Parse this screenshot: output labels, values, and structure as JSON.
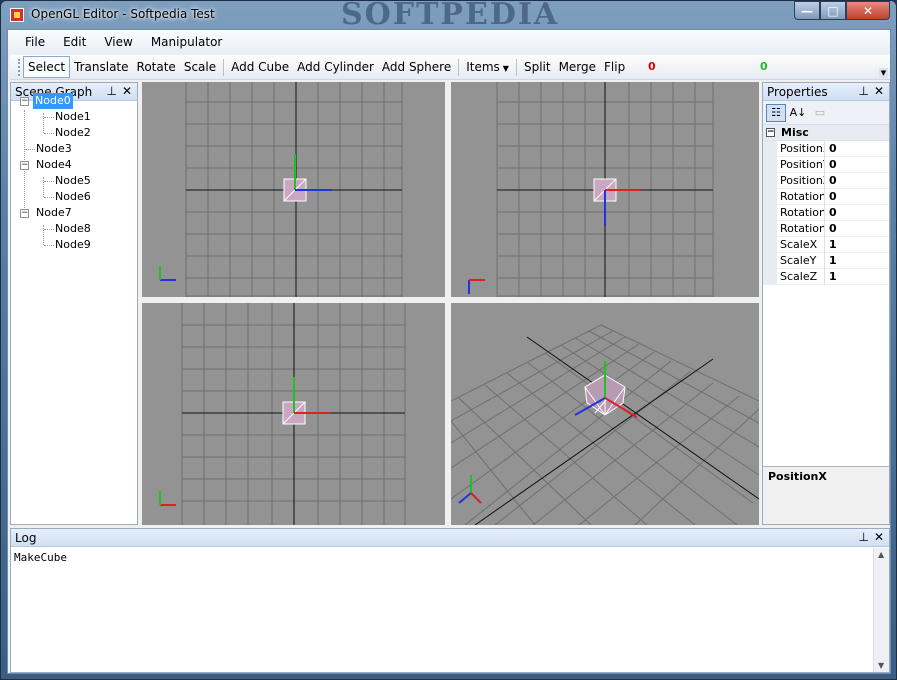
{
  "window": {
    "title": "OpenGL Editor - Softpedia Test",
    "watermark": "SOFTPEDIA",
    "minimize_glyph": "—",
    "maximize_glyph": "□",
    "close_glyph": "✕"
  },
  "menu": {
    "file": "File",
    "edit": "Edit",
    "view": "View",
    "manipulator": "Manipulator"
  },
  "toolbar": {
    "select": "Select",
    "translate": "Translate",
    "rotate": "Rotate",
    "scale": "Scale",
    "add_cube": "Add Cube",
    "add_cylinder": "Add Cylinder",
    "add_sphere": "Add Sphere",
    "items": "Items",
    "split": "Split",
    "merge": "Merge",
    "flip": "Flip",
    "status_red": "0",
    "status_green": "0"
  },
  "scene_graph": {
    "title": "Scene Graph",
    "nodes": [
      "Node0",
      "Node1",
      "Node2",
      "Node3",
      "Node4",
      "Node5",
      "Node6",
      "Node7",
      "Node8",
      "Node9"
    ],
    "selected": "Node0"
  },
  "properties": {
    "title": "Properties",
    "category": "Misc",
    "rows": [
      {
        "name": "PositionX",
        "value": "0"
      },
      {
        "name": "PositionY",
        "value": "0"
      },
      {
        "name": "PositionZ",
        "value": "0"
      },
      {
        "name": "RotationX",
        "value": "0"
      },
      {
        "name": "RotationY",
        "value": "0"
      },
      {
        "name": "RotationZ",
        "value": "0"
      },
      {
        "name": "ScaleX",
        "value": "1"
      },
      {
        "name": "ScaleY",
        "value": "1"
      },
      {
        "name": "ScaleZ",
        "value": "1"
      }
    ],
    "description_title": "PositionX"
  },
  "log": {
    "title": "Log",
    "lines": [
      "MakeCube"
    ]
  },
  "colors": {
    "grid_bg": "#939393",
    "grid_line": "#6f6f6f",
    "axis_x": "#e02020",
    "axis_y": "#22c022",
    "axis_z": "#2233dd",
    "selection": "#3399ff"
  }
}
